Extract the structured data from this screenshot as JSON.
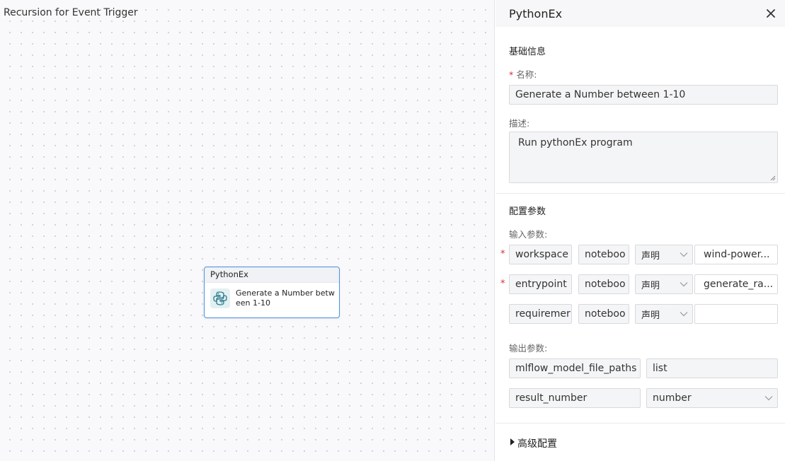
{
  "canvas": {
    "title": "Recursion for Event Trigger",
    "node": {
      "type_label": "PythonEx",
      "name": "Generate a Number between 1-10"
    }
  },
  "panel": {
    "title": "PythonEx",
    "basic_section": {
      "title": "基础信息",
      "name_label": "名称:",
      "name_value": "Generate a Number between 1-10",
      "desc_label": "描述:",
      "desc_value": "Run pythonEx program"
    },
    "config_section": {
      "title": "配置参数",
      "input_label": "输入参数:",
      "inputs": [
        {
          "required": "*",
          "name": "workspace",
          "type": "noteboo",
          "mode": "声明",
          "value": "wind-power..."
        },
        {
          "required": "*",
          "name": "entrypoint",
          "type": "noteboo",
          "mode": "声明",
          "value": "generate_ra..."
        },
        {
          "required": "",
          "name": "requiremer",
          "type": "noteboo",
          "mode": "声明",
          "value": ""
        }
      ],
      "output_label": "输出参数:",
      "outputs": [
        {
          "name": "mlflow_model_file_paths",
          "type": "list"
        },
        {
          "name": "result_number",
          "type": "number"
        }
      ]
    },
    "advanced_section": {
      "title": "高级配置"
    }
  }
}
